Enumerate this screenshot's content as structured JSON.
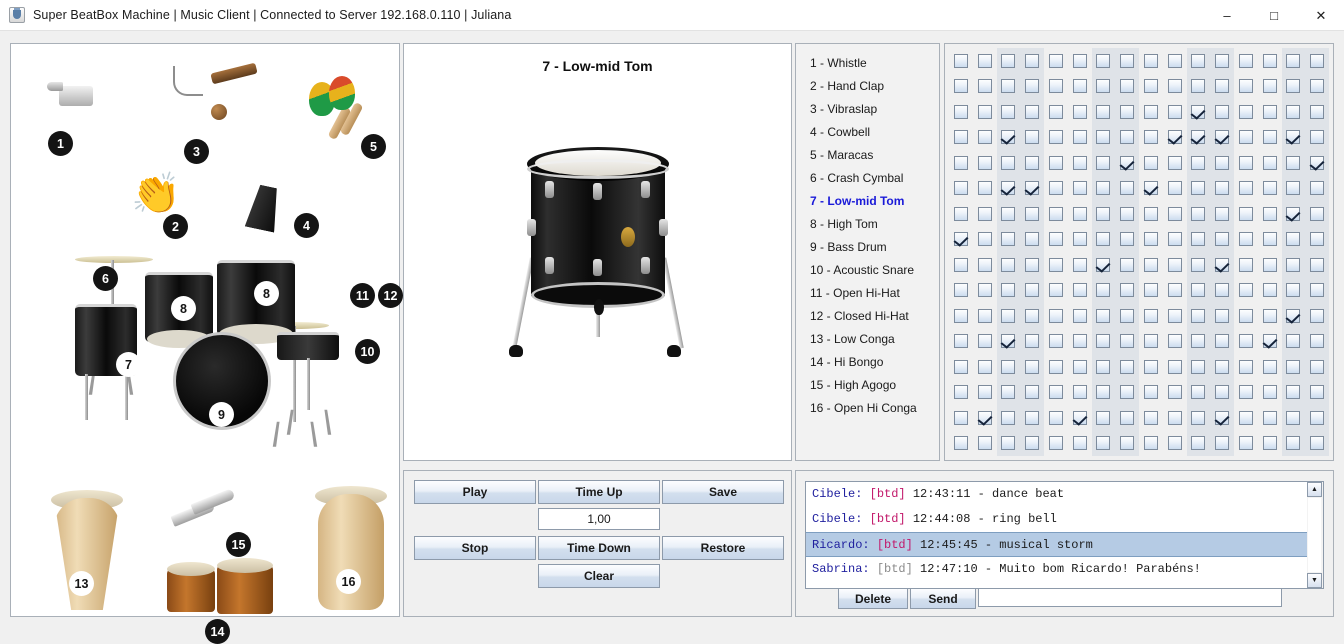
{
  "window": {
    "title": "Super BeatBox Machine | Music Client | Connected to Server 192.168.0.110 | Juliana",
    "app_icon": "java-coffee-cup-icon",
    "controls": {
      "minimize": "–",
      "maximize": "□",
      "close": "✕"
    }
  },
  "illustration": {
    "badges": [
      "1",
      "2",
      "3",
      "4",
      "5",
      "6",
      "7",
      "8",
      "8",
      "9",
      "10",
      "11",
      "12",
      "13",
      "14",
      "15",
      "16"
    ]
  },
  "display": {
    "title": "7 - Low-mid Tom",
    "image": "floor-tom-drum"
  },
  "transport": {
    "play": "Play",
    "time_up": "Time Up",
    "save": "Save",
    "tempo_value": "1,00",
    "stop": "Stop",
    "time_down": "Time Down",
    "restore": "Restore",
    "clear": "Clear"
  },
  "instruments": [
    {
      "index": 1,
      "label": "1 - Whistle",
      "selected": false
    },
    {
      "index": 2,
      "label": "2 - Hand Clap",
      "selected": false
    },
    {
      "index": 3,
      "label": "3 - Vibraslap",
      "selected": false
    },
    {
      "index": 4,
      "label": "4 - Cowbell",
      "selected": false
    },
    {
      "index": 5,
      "label": "5 - Maracas",
      "selected": false
    },
    {
      "index": 6,
      "label": "6 - Crash Cymbal",
      "selected": false
    },
    {
      "index": 7,
      "label": "7 - Low-mid Tom",
      "selected": true
    },
    {
      "index": 8,
      "label": "8 - High Tom",
      "selected": false
    },
    {
      "index": 9,
      "label": "9 - Bass Drum",
      "selected": false
    },
    {
      "index": 10,
      "label": "10 - Acoustic Snare",
      "selected": false
    },
    {
      "index": 11,
      "label": "11 - Open Hi-Hat",
      "selected": false
    },
    {
      "index": 12,
      "label": "12 - Closed Hi-Hat",
      "selected": false
    },
    {
      "index": 13,
      "label": "13 - Low Conga",
      "selected": false
    },
    {
      "index": 14,
      "label": "14 - Hi Bongo",
      "selected": false
    },
    {
      "index": 15,
      "label": "15 - High Agogo",
      "selected": false
    },
    {
      "index": 16,
      "label": "16 - Open Hi Conga",
      "selected": false
    }
  ],
  "grid": {
    "rows": 16,
    "columns": 16,
    "banded_columns": [
      3,
      4,
      7,
      8,
      11,
      12,
      15,
      16
    ],
    "checked": [
      [],
      [],
      [
        11
      ],
      [
        3,
        10,
        11,
        12,
        15
      ],
      [
        8,
        16
      ],
      [
        3,
        4,
        9
      ],
      [
        15
      ],
      [
        1
      ],
      [
        7,
        12
      ],
      [],
      [
        15
      ],
      [
        3,
        14
      ],
      [],
      [],
      [
        2,
        6,
        12
      ],
      []
    ]
  },
  "chat": {
    "messages": [
      {
        "name": "Cibele:",
        "tag": "[btd]",
        "tag_muted": false,
        "text": "12:43:11 - dance beat",
        "highlighted": false
      },
      {
        "name": "Cibele:",
        "tag": "[btd]",
        "tag_muted": false,
        "text": "12:44:08 - ring bell",
        "highlighted": false
      },
      {
        "name": "Ricardo:",
        "tag": "[btd]",
        "tag_muted": false,
        "text": "12:45:45 - musical storm",
        "highlighted": true
      },
      {
        "name": "Sabrina:",
        "tag": "[btd]",
        "tag_muted": true,
        "text": "12:47:10 - Muito bom Ricardo! Parabéns!",
        "highlighted": false
      }
    ],
    "scroll_up": "▲",
    "scroll_down": "▼",
    "delete_label": "Delete",
    "send_label": "Send",
    "input_value": "",
    "input_placeholder": ""
  },
  "colors": {
    "accent_selected": "#1919d8",
    "chat_name": "#1f1f9e",
    "chat_tag": "#c2186a",
    "chat_highlight": "#b5cbe4",
    "band": "#dfe3e8",
    "window_bg": "#f0f0f0"
  }
}
